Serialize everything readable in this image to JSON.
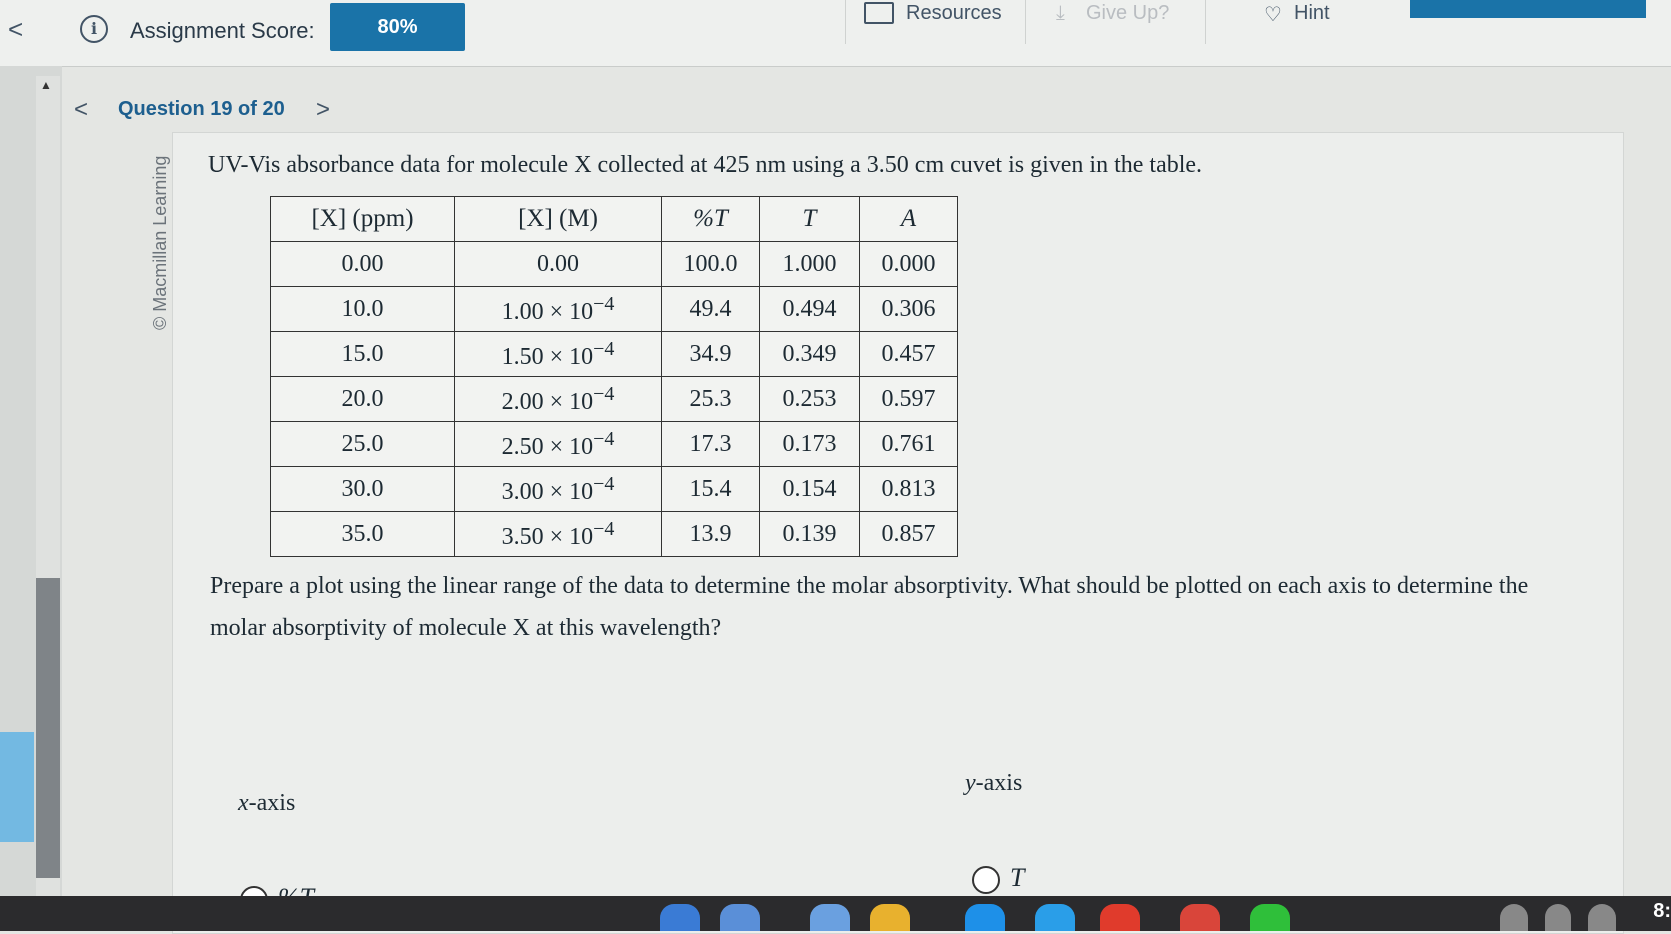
{
  "topbar": {
    "back_glyph": "<",
    "score_label": "Assignment Score:",
    "score_value": "80%",
    "resources_label": "Resources",
    "giveup_label": "Give Up?",
    "hint_label": "Hint"
  },
  "question_nav": {
    "prev_glyph": "<",
    "title": "Question 19 of 20",
    "next_glyph": ">"
  },
  "question": {
    "copyright": "© Macmillan Learning",
    "intro": "UV-Vis absorbance data for molecule X collected at 425 nm using a 3.50 cm cuvet is given in the table.",
    "table": {
      "headers": [
        "[X] (ppm)",
        "[X] (M)",
        "%T",
        "T",
        "A"
      ],
      "rows": [
        [
          "0.00",
          "0.00",
          "100.0",
          "1.000",
          "0.000"
        ],
        [
          "10.0",
          "1.00 × 10",
          "49.4",
          "0.494",
          "0.306"
        ],
        [
          "15.0",
          "1.50 × 10",
          "34.9",
          "0.349",
          "0.457"
        ],
        [
          "20.0",
          "2.00 × 10",
          "25.3",
          "0.253",
          "0.597"
        ],
        [
          "25.0",
          "2.50 × 10",
          "17.3",
          "0.173",
          "0.761"
        ],
        [
          "30.0",
          "3.00 × 10",
          "15.4",
          "0.154",
          "0.813"
        ],
        [
          "35.0",
          "3.50 × 10",
          "13.9",
          "0.139",
          "0.857"
        ]
      ],
      "exponent": "−4"
    },
    "prompt": "Prepare a plot using the linear range of the data to determine the molar absorptivity. What should be plotted on each axis to determine the molar absorptivity of molecule X at this wavelength?",
    "x_axis_label_var": "x",
    "x_axis_label_rest": "-axis",
    "y_axis_label_var": "y",
    "y_axis_label_rest": "-axis",
    "x_option_first": "%T",
    "y_option_first": "T"
  },
  "taskbar": {
    "clock": "8:"
  },
  "colors": {
    "accent": "#1a73a8",
    "link": "#1d5f8f",
    "scroll_highlight": "#73b9e2"
  }
}
